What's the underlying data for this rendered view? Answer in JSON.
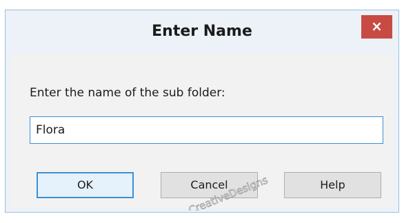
{
  "dialog": {
    "title": "Enter Name",
    "close_label": "×",
    "prompt": "Enter the name of the sub folder:",
    "input_value": "Flora",
    "buttons": {
      "ok": "OK",
      "cancel": "Cancel",
      "help": "Help"
    },
    "watermark": "CreativeDesigns",
    "colors": {
      "close_button": "#c74b43",
      "focus_border": "#3c8fd6",
      "frame": "#ecf2f8"
    }
  }
}
